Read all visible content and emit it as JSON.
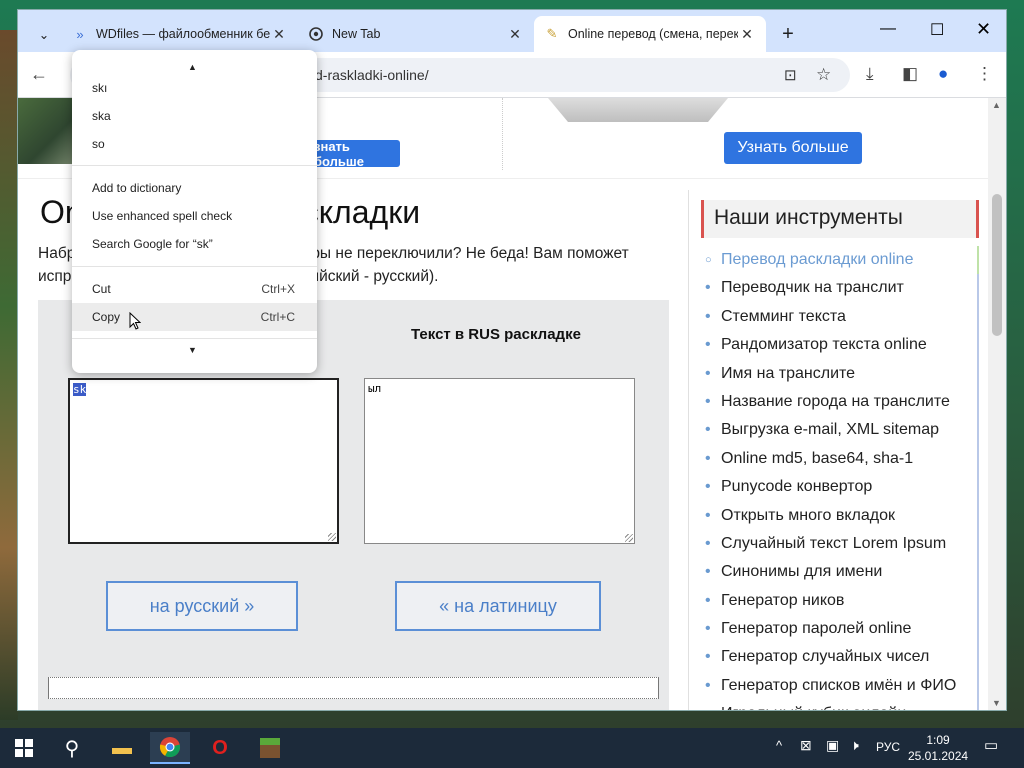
{
  "tabs": [
    {
      "title": "WDfiles — файлообменник бе",
      "icon": "wdfiles-icon"
    },
    {
      "title": "New Tab",
      "icon": "chrome-icon"
    },
    {
      "title": "Online перевод (смена, перек",
      "icon": "site-favicon"
    }
  ],
  "address": {
    "url": "d-raskladki-online/"
  },
  "ad": {
    "button_left": "знать больше",
    "button_right": "Узнать больше"
  },
  "page": {
    "title_left": "On",
    "title_right": "складки",
    "intro_line1_left": "Набр",
    "intro_line1_right": "ры не переключили? Не беда! Вам поможет",
    "intro_line2_left": "испр",
    "intro_line2_right": "ийский - русский).",
    "rus_label": "Текст в RUS раскладке",
    "latin_selected": "sk",
    "rus_text": "ыл",
    "btn_to_rus": "на русский »",
    "btn_to_lat": "« на латиницу"
  },
  "sidebar": {
    "heading": "Наши инструменты",
    "items": [
      "Перевод раскладки online",
      "Переводчик на транслит",
      "Стемминг текста",
      "Рандомизатор текста online",
      "Имя на транслите",
      "Название города на транслите",
      "Выгрузка e-mail, XML sitemap",
      "Online md5, base64, sha-1",
      "Punycode конвертор",
      "Открыть много вкладок",
      "Случайный текст Lorem Ipsum",
      "Синонимы для имени",
      "Генератор ников",
      "Генератор паролей online",
      "Генератор случайных чисел",
      "Генератор списков имён и ФИО",
      "Игральный кубик онлайн"
    ]
  },
  "context_menu": {
    "suggestions": [
      "skı",
      "ska",
      "so"
    ],
    "items": [
      {
        "label": "Add to dictionary"
      },
      {
        "label": "Use enhanced spell check"
      },
      {
        "label": "Search Google for “sk”"
      }
    ],
    "edit": [
      {
        "label": "Cut",
        "shortcut": "Ctrl+X"
      },
      {
        "label": "Copy",
        "shortcut": "Ctrl+C"
      }
    ]
  },
  "taskbar": {
    "lang": "РУС",
    "time": "1:09",
    "date": "25.01.2024"
  }
}
